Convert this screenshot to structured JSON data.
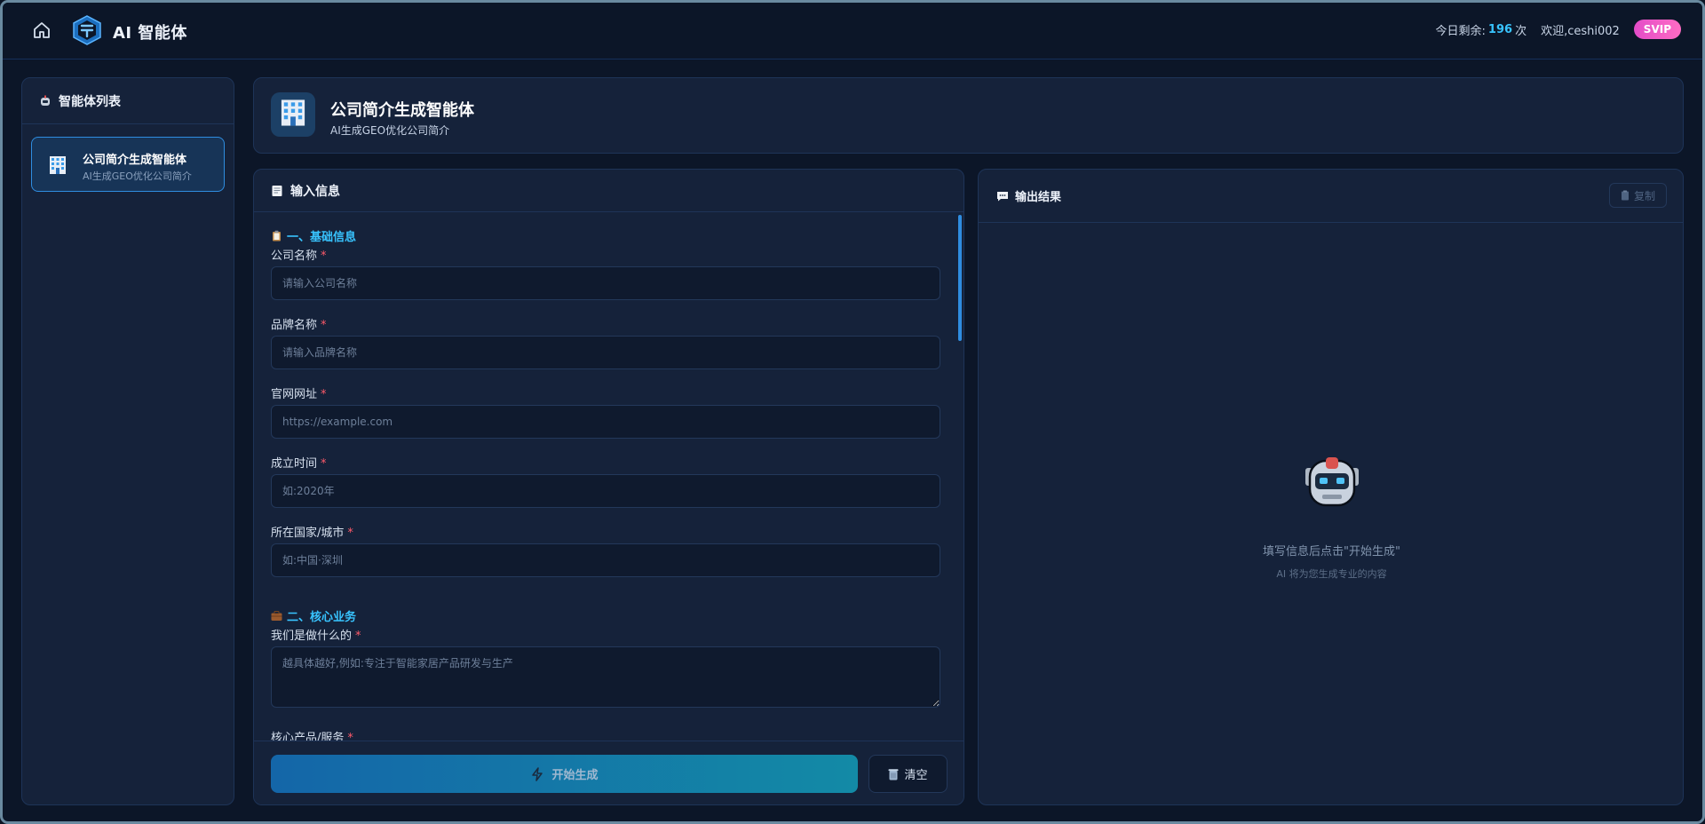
{
  "header": {
    "app_title": "AI 智能体",
    "quota_label": "今日剩余:",
    "quota_value": "196",
    "quota_unit": "次",
    "welcome": "欢迎,ceshi002",
    "vip_badge": "SVIP"
  },
  "sidebar": {
    "title": "智能体列表",
    "items": [
      {
        "name": "公司简介生成智能体",
        "desc": "AI生成GEO优化公司简介"
      }
    ]
  },
  "agent": {
    "title": "公司简介生成智能体",
    "subtitle": "AI生成GEO优化公司简介"
  },
  "input_panel": {
    "title": "输入信息",
    "section_basic": "一、基础信息",
    "section_core": "二、核心业务",
    "fields": {
      "company_name": {
        "label": "公司名称",
        "placeholder": "请输入公司名称",
        "value": ""
      },
      "brand_name": {
        "label": "品牌名称",
        "placeholder": "请输入品牌名称",
        "value": ""
      },
      "website": {
        "label": "官网网址",
        "placeholder": "https://example.com",
        "value": ""
      },
      "founded": {
        "label": "成立时间",
        "placeholder": "如:2020年",
        "value": ""
      },
      "location": {
        "label": "所在国家/城市",
        "placeholder": "如:中国·深圳",
        "value": ""
      },
      "what_we_do": {
        "label": "我们是做什么的",
        "placeholder": "越具体越好,例如:专注于智能家居产品研发与生产",
        "value": ""
      },
      "core_products": {
        "label": "核心产品/服务"
      }
    },
    "required_mark": "*",
    "generate_label": "开始生成",
    "clear_label": "清空"
  },
  "output_panel": {
    "title": "输出结果",
    "copy_label": "复制",
    "empty_title": "填写信息后点击\"开始生成\"",
    "empty_subtitle": "AI 将为您生成专业的内容"
  },
  "colors": {
    "accent": "#38c4ff",
    "required": "#ff5a6a",
    "vip": "#e34cc8"
  }
}
